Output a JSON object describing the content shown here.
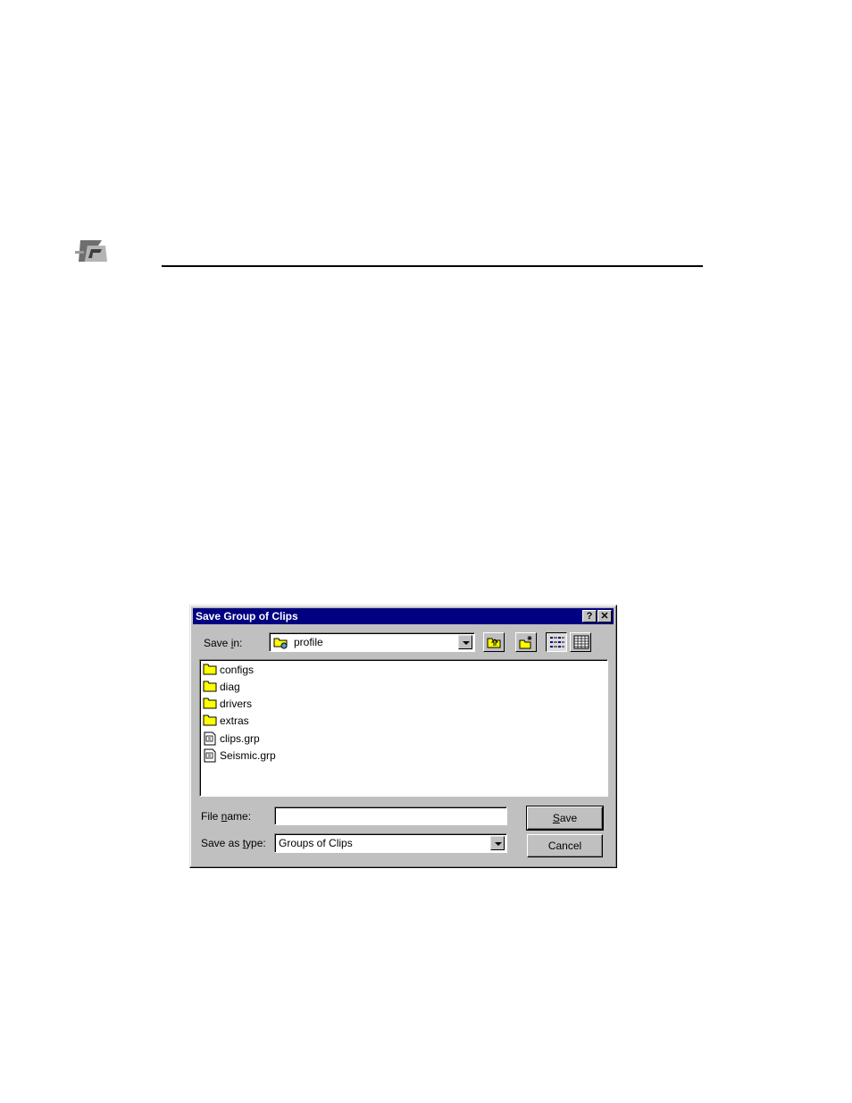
{
  "dialog": {
    "title": "Save Group of Clips",
    "help_icon": "?",
    "close_icon": "✕",
    "save_in": {
      "label_prefix": "Save ",
      "label_accel": "i",
      "label_suffix": "n:",
      "value": "profile",
      "icon": "folder-network-icon"
    },
    "toolbar": {
      "up_folder": "up-one-level-icon",
      "new_folder": "new-folder-icon",
      "list_view": "list-view-icon",
      "details_view": "details-view-icon"
    },
    "files": [
      {
        "name": "configs",
        "icon": "folder-icon"
      },
      {
        "name": "diag",
        "icon": "folder-icon"
      },
      {
        "name": "drivers",
        "icon": "folder-icon"
      },
      {
        "name": "extras",
        "icon": "folder-icon"
      },
      {
        "name": "clips.grp",
        "icon": "document-icon"
      },
      {
        "name": "Seismic.grp",
        "icon": "document-icon"
      }
    ],
    "file_name": {
      "label_prefix": "File ",
      "label_accel": "n",
      "label_suffix": "ame:",
      "value": ""
    },
    "save_as_type": {
      "label_prefix": "Save as ",
      "label_accel": "t",
      "label_suffix": "ype:",
      "value": "Groups of Clips"
    },
    "save_button": {
      "accel": "S",
      "rest": "ave"
    },
    "cancel_button": "Cancel"
  },
  "colors": {
    "titlebar": "#000080",
    "face": "#c0c0c0",
    "folder": "#ffff00"
  }
}
